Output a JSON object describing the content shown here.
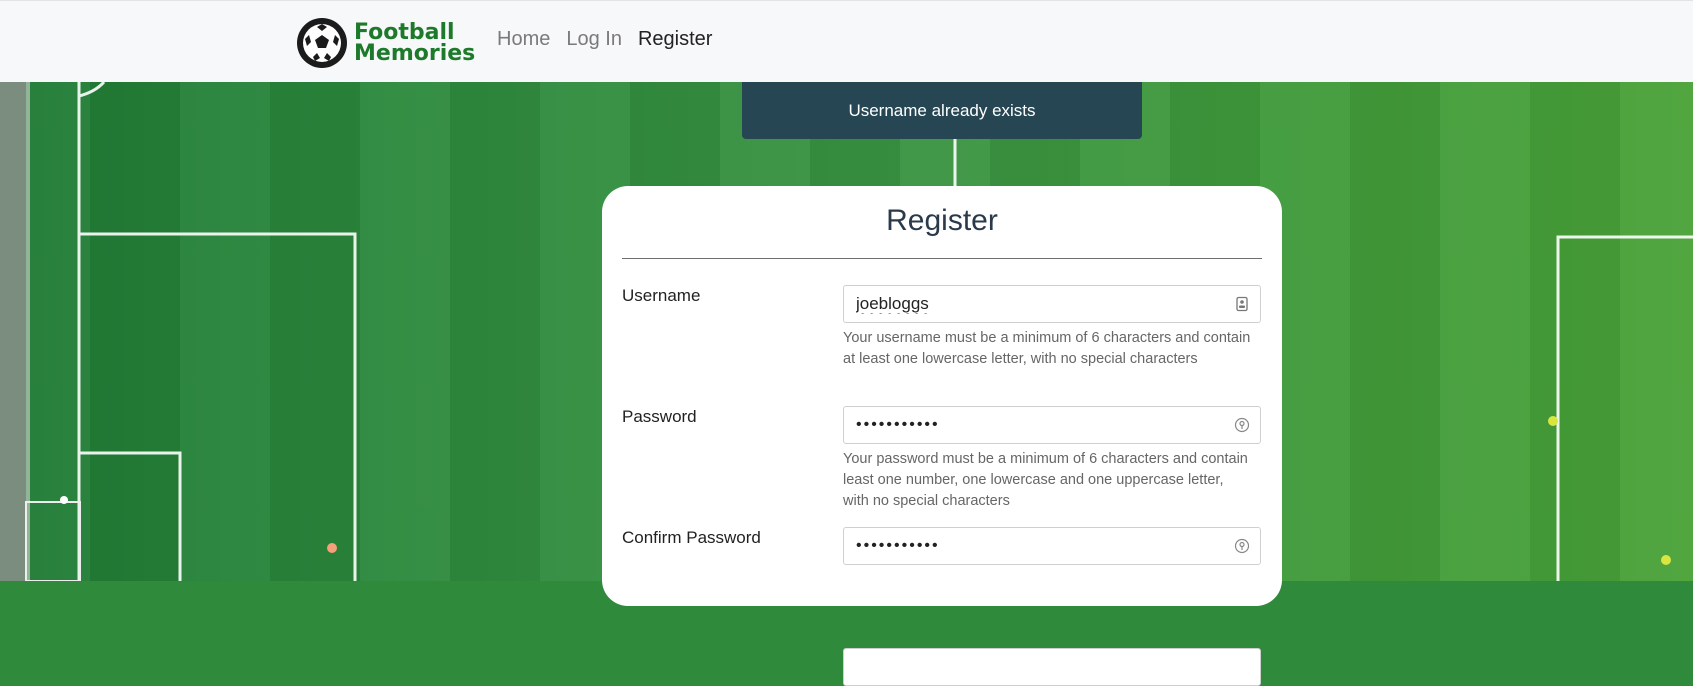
{
  "navbar": {
    "brand_line1": "Football",
    "brand_line2": "Memories",
    "links": [
      "Home",
      "Log In",
      "Register"
    ],
    "active_link": "Register"
  },
  "flash": {
    "message": "Username already exists"
  },
  "form": {
    "title": "Register",
    "username": {
      "label": "Username",
      "value": "joebloggs",
      "help": "Your username must be a minimum of 6 characters and contain at least one lowercase letter, with no special characters"
    },
    "password": {
      "label": "Password",
      "value": "•••••••••••",
      "help": "Your password must be a minimum of 6 characters and contain least one number, one lowercase and one uppercase letter, with no special characters"
    },
    "confirm_password": {
      "label": "Confirm Password",
      "value": "•••••••••••"
    }
  },
  "colors": {
    "brand_green": "#1d7a2b",
    "flash_bg": "#264653",
    "navbar_bg": "#f7f8f9"
  },
  "icons": [
    "football-logo-icon",
    "contact-card-icon",
    "key-icon"
  ]
}
